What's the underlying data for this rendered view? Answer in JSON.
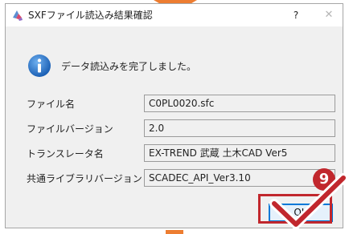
{
  "dialog": {
    "title": "SXFファイル読込み結果確認",
    "help_label": "?",
    "close_label": "✕",
    "message": "データ読込みを完了しました。",
    "rows": [
      {
        "label": "ファイル名",
        "value": "C0PL0020.sfc"
      },
      {
        "label": "ファイルバージョン",
        "value": "2.0"
      },
      {
        "label": "トランスレータ名",
        "value": "EX-TREND 武蔵 土木CAD Ver5"
      },
      {
        "label": "共通ライブラリバージョン",
        "value": "SCADEC_API_Ver3.10"
      }
    ],
    "ok_label": "OK"
  },
  "annotation": {
    "step_number": "9",
    "color": "#c1272d",
    "arrow_color": "#ed7d31"
  },
  "icons": {
    "app": "sxf-app-icon",
    "info": "info-icon",
    "check": "checkmark-icon"
  }
}
